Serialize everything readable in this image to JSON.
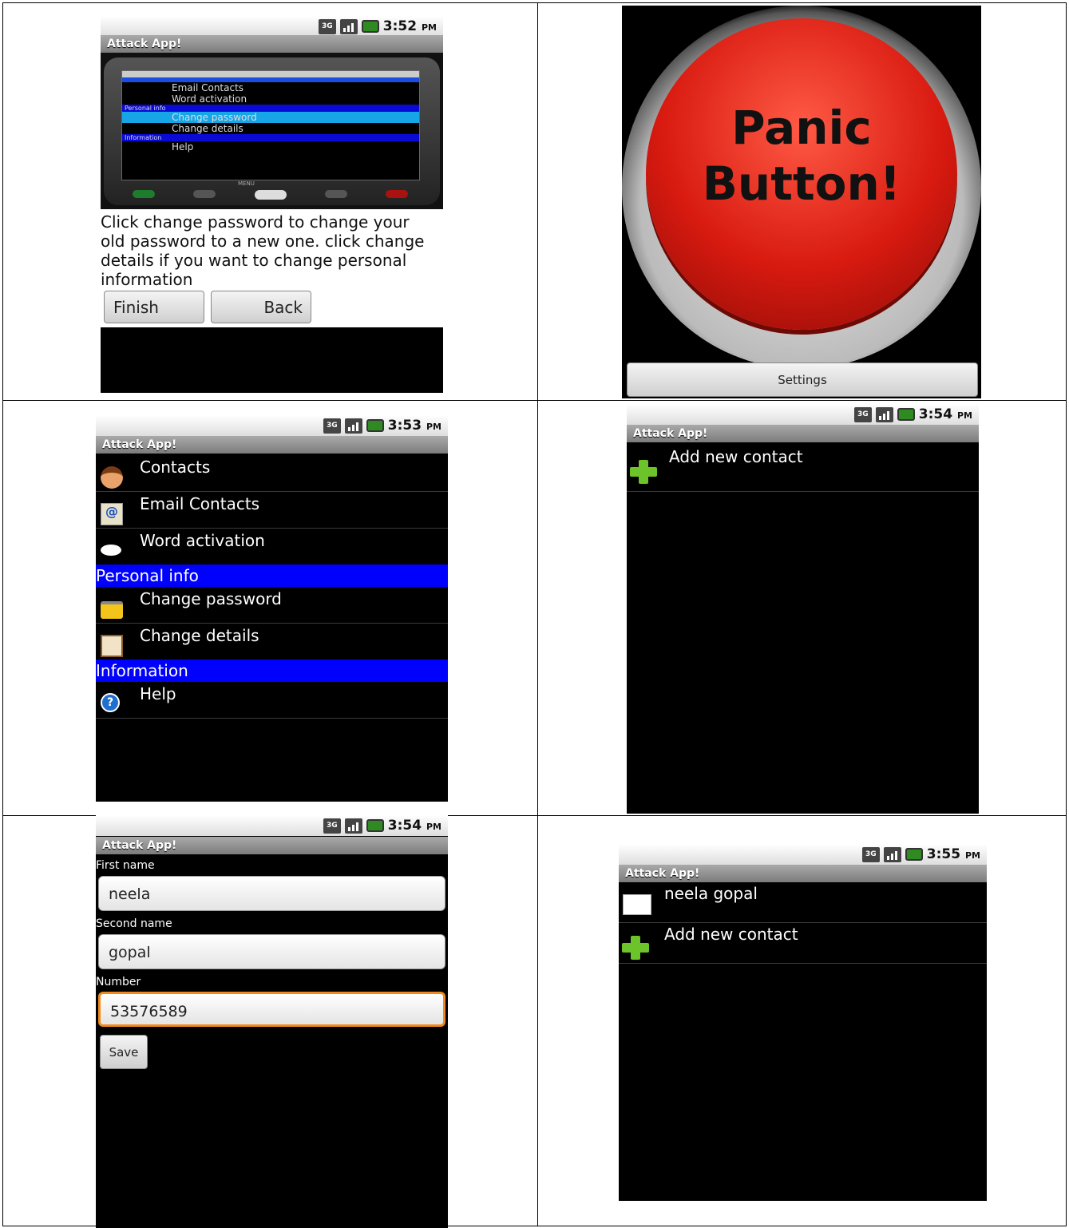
{
  "status": {
    "net": "3G",
    "times": [
      "3:52",
      "3:53",
      "3:54",
      "3:54",
      "3:55"
    ],
    "ampm": "PM"
  },
  "app_title": "Attack App!",
  "help_screen": {
    "description": "Click change password to change your old password to a new one. click change details if you want to change personal information",
    "finish": "Finish",
    "back": "Back",
    "preview_items": [
      "Email Contacts",
      "Word activation",
      "Personal info",
      "Change password",
      "Change details",
      "Information",
      "Help"
    ],
    "preview_menu": "MENU"
  },
  "panic_screen": {
    "button_line1": "Panic",
    "button_line2": "Button!",
    "settings": "Settings"
  },
  "menu_screen": {
    "items": [
      {
        "label": "Contacts",
        "icon": "person-icon"
      },
      {
        "label": "Email Contacts",
        "icon": "email-icon"
      },
      {
        "label": "Word activation",
        "icon": "speech-bubble-icon"
      }
    ],
    "section_personal": "Personal info",
    "personal_items": [
      {
        "label": "Change password",
        "icon": "lock-icon"
      },
      {
        "label": "Change details",
        "icon": "id-card-icon"
      }
    ],
    "section_info": "Information",
    "info_items": [
      {
        "label": "Help",
        "icon": "help-icon"
      }
    ]
  },
  "contacts_empty_screen": {
    "add_label": "Add new contact"
  },
  "form_screen": {
    "first_name_label": "First name",
    "first_name_value": "neela",
    "second_name_label": "Second name",
    "second_name_value": "gopal",
    "number_label": "Number",
    "number_value": "53576589",
    "save": "Save"
  },
  "contacts_list_screen": {
    "contact_name": "neela gopal",
    "add_label": "Add new contact"
  },
  "colors": {
    "section_blue": "#0000ff",
    "panic_red": "#d81a10",
    "focus_orange": "#f08a1c",
    "plus_green": "#6cc32a"
  }
}
